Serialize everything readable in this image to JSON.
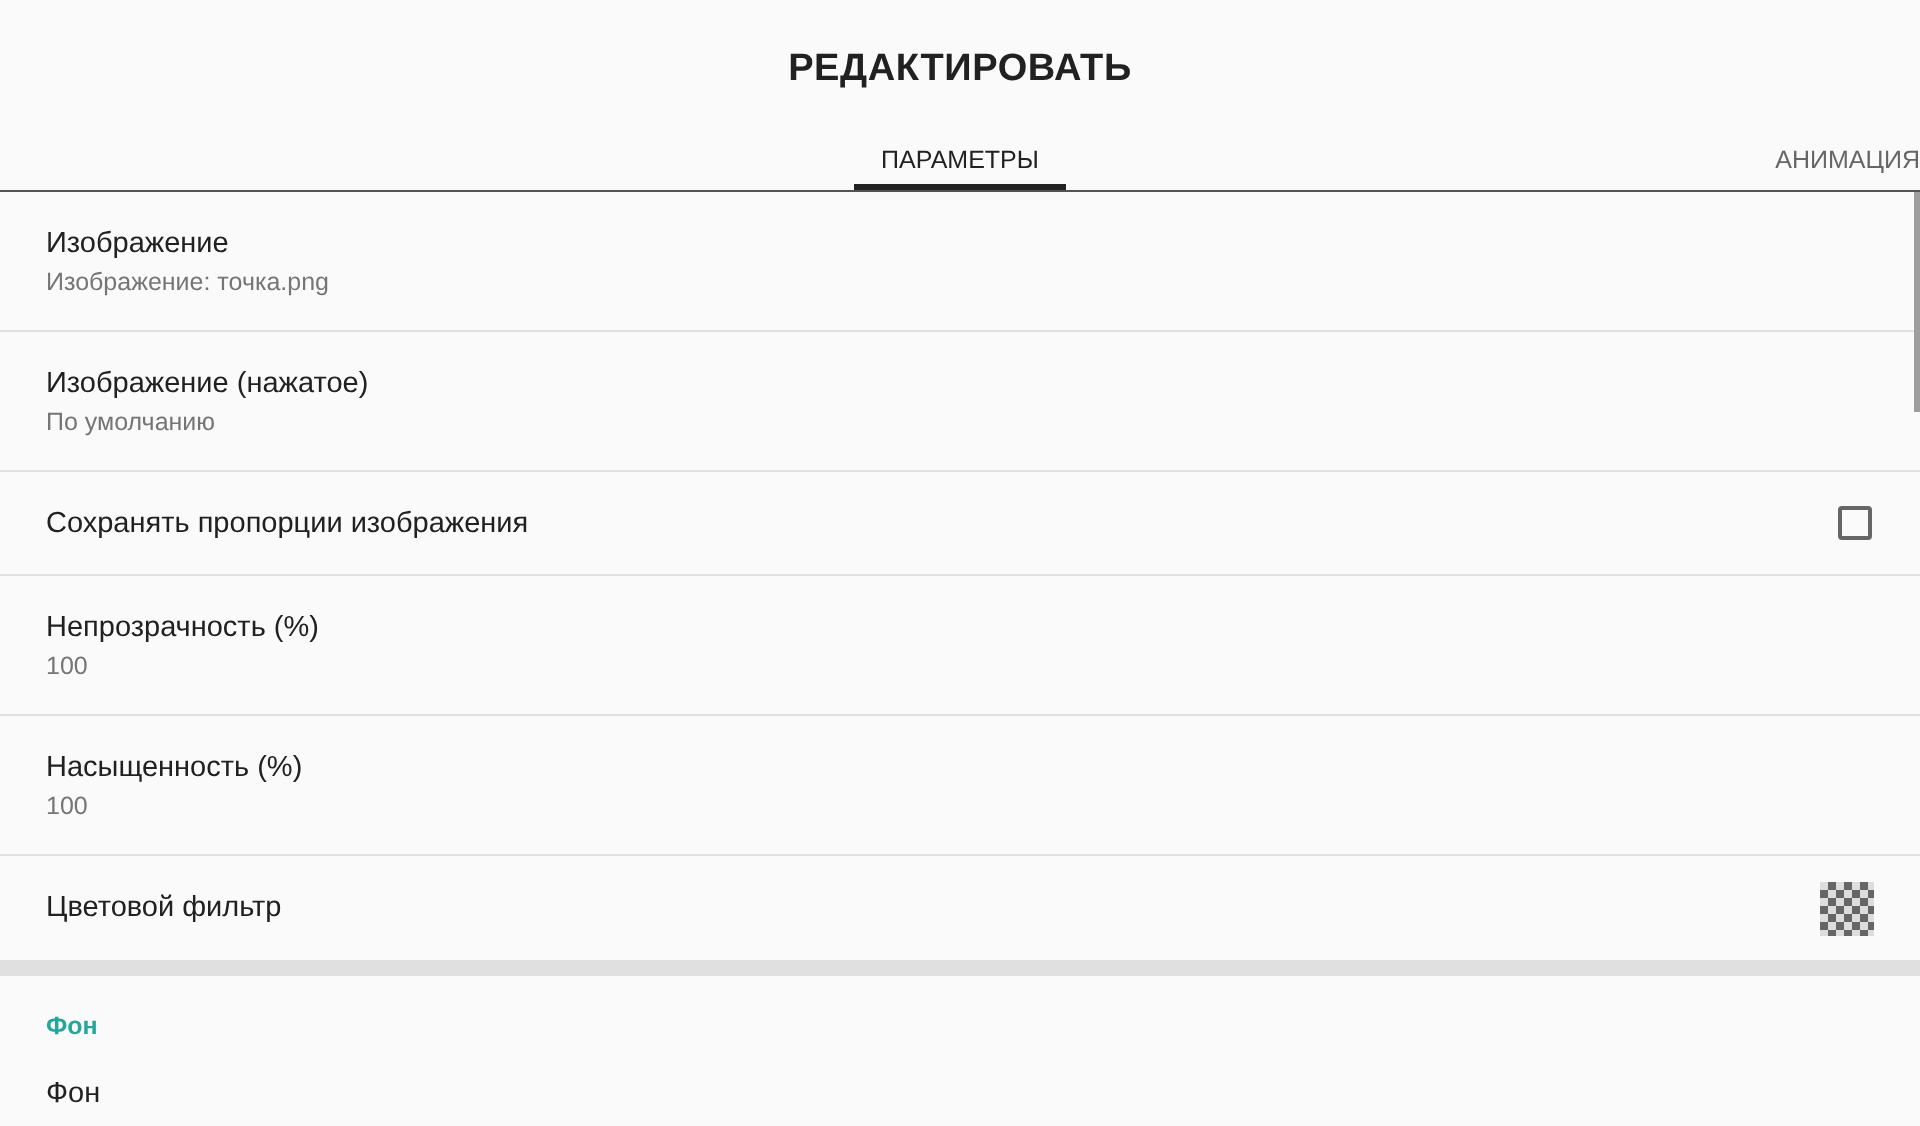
{
  "title": "РЕДАКТИРОВАТЬ",
  "tabs": [
    {
      "label": "ПАРАМЕТРЫ",
      "selected": true
    },
    {
      "label": "АНИМАЦИЯ",
      "selected": false
    }
  ],
  "settings": [
    {
      "kind": "text",
      "title": "Изображение",
      "subtitle": "Изображение: точка.png"
    },
    {
      "kind": "text",
      "title": "Изображение (нажатое)",
      "subtitle": "По умолчанию"
    },
    {
      "kind": "checkbox",
      "title": "Сохранять пропорции изображения",
      "checked": false
    },
    {
      "kind": "text",
      "title": "Непрозрачность (%)",
      "subtitle": "100"
    },
    {
      "kind": "text",
      "title": "Насыщенность (%)",
      "subtitle": "100"
    },
    {
      "kind": "swatch",
      "title": "Цветовой фильтр"
    }
  ],
  "background_section": {
    "header": "Фон",
    "items": [
      {
        "title": "Фон"
      }
    ]
  }
}
